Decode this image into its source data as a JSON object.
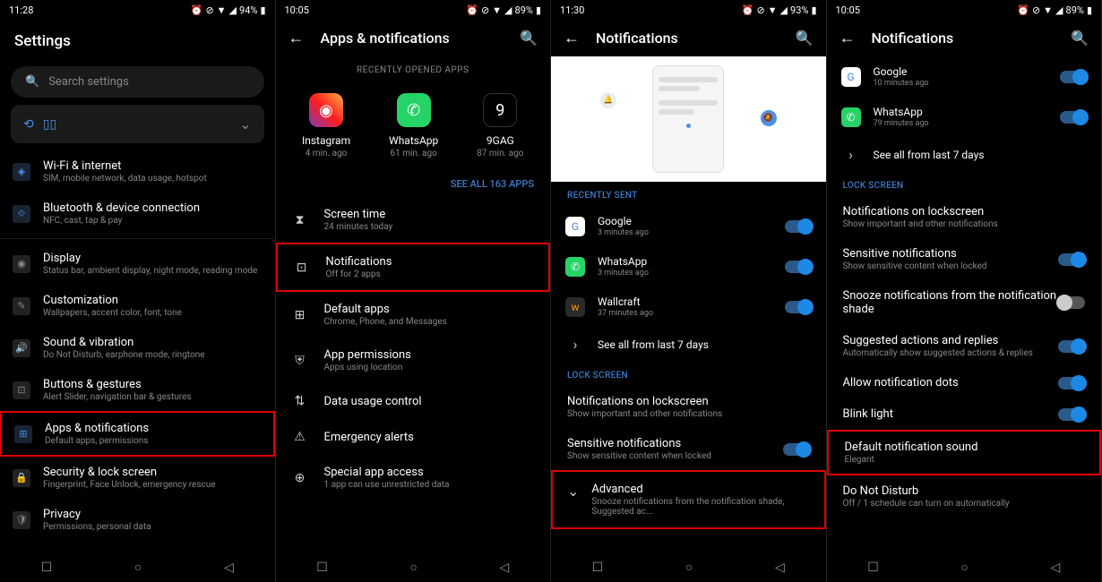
{
  "screen1": {
    "time": "11:28",
    "battery": "94%",
    "title": "Settings",
    "search_placeholder": "Search settings",
    "items": [
      {
        "title": "Wi-Fi & internet",
        "sub": "SIM, mobile network, data usage, hotspot"
      },
      {
        "title": "Bluetooth & device connection",
        "sub": "NFC, cast, tap & pay"
      },
      {
        "title": "Display",
        "sub": "Status bar, ambient display, night mode, reading mode"
      },
      {
        "title": "Customization",
        "sub": "Wallpapers, accent color, font, tone"
      },
      {
        "title": "Sound & vibration",
        "sub": "Do Not Disturb, earphone mode, ringtone"
      },
      {
        "title": "Buttons & gestures",
        "sub": "Alert Slider, navigation bar & gestures"
      },
      {
        "title": "Apps & notifications",
        "sub": "Default apps, permissions"
      },
      {
        "title": "Security & lock screen",
        "sub": "Fingerprint, Face Unlock, emergency rescue"
      },
      {
        "title": "Privacy",
        "sub": "Permissions, personal data"
      }
    ]
  },
  "screen2": {
    "time": "10:05",
    "battery": "89%",
    "title": "Apps & notifications",
    "section1": "RECENTLY OPENED APPS",
    "apps": [
      {
        "name": "Instagram",
        "time": "4 min. ago"
      },
      {
        "name": "WhatsApp",
        "time": "61 min. ago"
      },
      {
        "name": "9GAG",
        "time": "87 min. ago"
      }
    ],
    "see_all": "SEE ALL 163 APPS",
    "settings": [
      {
        "title": "Screen time",
        "sub": "24 minutes today"
      },
      {
        "title": "Notifications",
        "sub": "Off for 2 apps"
      },
      {
        "title": "Default apps",
        "sub": "Chrome, Phone, and Messages"
      },
      {
        "title": "App permissions",
        "sub": "Apps using location"
      },
      {
        "title": "Data usage control",
        "sub": ""
      },
      {
        "title": "Emergency alerts",
        "sub": ""
      },
      {
        "title": "Special app access",
        "sub": "1 app can use unrestricted data"
      }
    ]
  },
  "screen3": {
    "time": "11:30",
    "battery": "93%",
    "title": "Notifications",
    "section1": "RECENTLY SENT",
    "notifs": [
      {
        "name": "Google",
        "time": "3 minutes ago"
      },
      {
        "name": "WhatsApp",
        "time": "3 minutes ago"
      },
      {
        "name": "Wallcraft",
        "time": "37 minutes ago"
      }
    ],
    "see_all": "See all from last 7 days",
    "section2": "LOCK SCREEN",
    "lock_items": [
      {
        "title": "Notifications on lockscreen",
        "sub": "Show important and other notifications"
      },
      {
        "title": "Sensitive notifications",
        "sub": "Show sensitive content when locked"
      }
    ],
    "advanced_title": "Advanced",
    "advanced_sub": "Snooze notifications from the notification shade, Suggested ac..."
  },
  "screen4": {
    "time": "10:05",
    "battery": "89%",
    "title": "Notifications",
    "notifs": [
      {
        "name": "Google",
        "time": "10 minutes ago"
      },
      {
        "name": "WhatsApp",
        "time": "79 minutes ago"
      }
    ],
    "see_all": "See all from last 7 days",
    "section": "LOCK SCREEN",
    "items": [
      {
        "title": "Notifications on lockscreen",
        "sub": "Show important and other notifications",
        "toggle": null
      },
      {
        "title": "Sensitive notifications",
        "sub": "Show sensitive content when locked",
        "toggle": true
      },
      {
        "title": "Snooze notifications from the notification shade",
        "sub": "",
        "toggle": false
      },
      {
        "title": "Suggested actions and replies",
        "sub": "Automatically show suggested actions & replies",
        "toggle": true
      },
      {
        "title": "Allow notification dots",
        "sub": "",
        "toggle": true
      },
      {
        "title": "Blink light",
        "sub": "",
        "toggle": true
      },
      {
        "title": "Default notification sound",
        "sub": "Elegant",
        "toggle": null
      },
      {
        "title": "Do Not Disturb",
        "sub": "Off / 1 schedule can turn on automatically",
        "toggle": null
      }
    ]
  }
}
